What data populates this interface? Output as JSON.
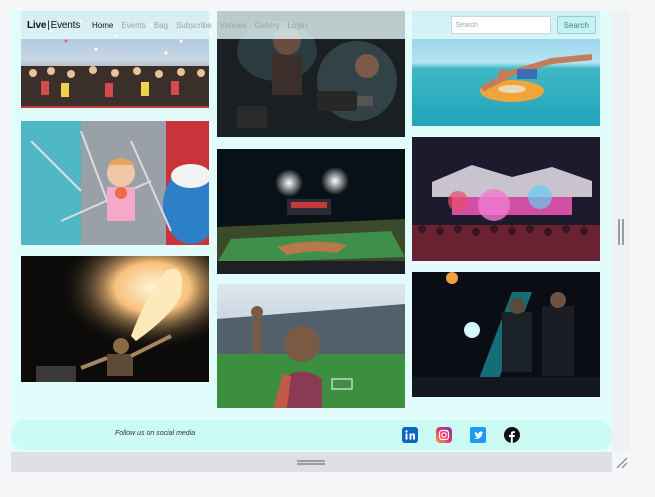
{
  "brand": {
    "live": "Live",
    "separator": "|",
    "events": "Events"
  },
  "nav": {
    "items": [
      {
        "label": "Home",
        "active": true
      },
      {
        "label": "Events"
      },
      {
        "label": "Bag"
      },
      {
        "label": "Subscribe"
      },
      {
        "label": "Venues"
      },
      {
        "label": "Gallery"
      },
      {
        "label": "Login"
      }
    ]
  },
  "search": {
    "placeholder": "Search",
    "value": "",
    "button_label": "Search"
  },
  "footer": {
    "text": "Follow us on social media",
    "social_icons": [
      "linkedin-icon",
      "instagram-icon",
      "twitter-icon",
      "facebook-icon"
    ]
  },
  "colors": {
    "page_bg": "#e2fbfb",
    "footer_bg": "#ccfbf6",
    "accent": "#2a8f9c"
  }
}
